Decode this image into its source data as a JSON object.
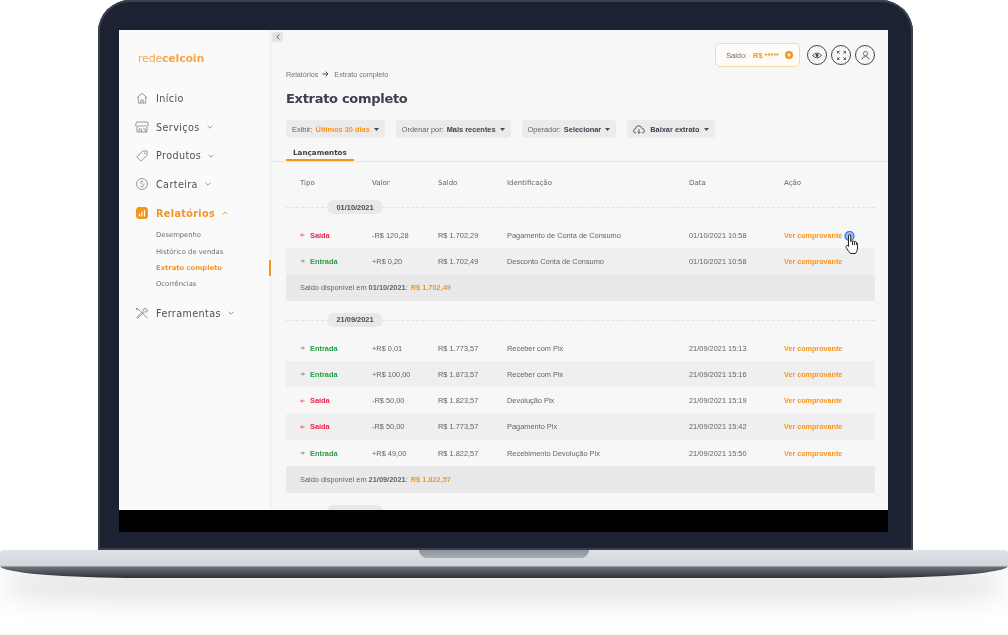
{
  "sidebar": {
    "logo": "rede**celcoin**",
    "items": [
      {
        "label": "Início",
        "kind": "link",
        "selected": false
      },
      {
        "label": "Serviços",
        "kind": "group",
        "expanded": false,
        "selected": false
      },
      {
        "label": "Produtos",
        "kind": "group",
        "expanded": false,
        "selected": false
      },
      {
        "label": "Carteira",
        "kind": "group",
        "expanded": false,
        "selected": false
      },
      {
        "label": "Relatórios",
        "kind": "group",
        "expanded": true,
        "selected": true,
        "children": [
          {
            "label": "Desempenho",
            "selected": false
          },
          {
            "label": "Histórico de vendas",
            "selected": false
          },
          {
            "label": "Extrato completo",
            "selected": true
          },
          {
            "label": "Ocorrências",
            "selected": false
          }
        ]
      },
      {
        "label": "Ferramentas",
        "kind": "group",
        "expanded": false,
        "selected": false
      }
    ]
  },
  "header": {
    "balance": {
      "label": "Saldo:",
      "value": "R$ *****"
    }
  },
  "breadcrumb": [
    "Relatórios",
    "Extrato completo"
  ],
  "title": "Extrato completo",
  "filters": [
    {
      "kind": "select",
      "label": "Exibir:",
      "value": "Últimos 30 dias",
      "highlighted": true
    },
    {
      "kind": "select",
      "label": "Ordenar por:",
      "value": "Mais recentes",
      "highlighted": false
    },
    {
      "kind": "select",
      "label": "Operador:",
      "value": "Selecionar",
      "highlighted": false
    },
    {
      "kind": "download",
      "value": "Baixar extrato"
    }
  ],
  "tabs": [
    {
      "label": "Lançamentos",
      "selected": true
    }
  ],
  "table": {
    "columns": [
      "Tipo",
      "Valor",
      "Saldo",
      "Identificação",
      "Data",
      "Ação"
    ],
    "groups": [
      {
        "date": "01/10/2021",
        "rows": [
          {
            "kind": "out",
            "type": "Saída",
            "value": "-R$ 120,28",
            "balance": "R$ 1.702,29",
            "description": "Pagamento de Conta de Consumo",
            "datetime": "01/10/2021 10:58",
            "action": "Ver comprovante"
          },
          {
            "kind": "in",
            "type": "Entrada",
            "value": "+R$ 0,20",
            "balance": "R$ 1.702,49",
            "description": "Desconto Conta de Consumo",
            "datetime": "01/10/2021 10:58",
            "action": "Ver comprovante"
          }
        ],
        "summary": {
          "label": "Saldo disponível em **01/10/2021**:",
          "amount": "R$ 1.702,49"
        }
      },
      {
        "date": "21/09/2021",
        "rows": [
          {
            "kind": "in",
            "type": "Entrada",
            "value": "+R$ 0,01",
            "balance": "R$ 1.773,57",
            "description": "Receber com Pix",
            "datetime": "21/09/2021 15:13",
            "action": "Ver comprovante"
          },
          {
            "kind": "in",
            "type": "Entrada",
            "value": "+R$ 100,00",
            "balance": "R$ 1.873,57",
            "description": "Receber com Pix",
            "datetime": "21/09/2021 15:16",
            "action": "Ver comprovante"
          },
          {
            "kind": "out",
            "type": "Saída",
            "value": "-R$ 50,00",
            "balance": "R$ 1.823,57",
            "description": "Devolução Pix",
            "datetime": "21/09/2021 15:19",
            "action": "Ver comprovante"
          },
          {
            "kind": "out",
            "type": "Saída",
            "value": "-R$ 50,00",
            "balance": "R$ 1.773,57",
            "description": "Pagamento Pix",
            "datetime": "21/09/2021 15:42",
            "action": "Ver comprovante"
          },
          {
            "kind": "in",
            "type": "Entrada",
            "value": "+R$ 49,00",
            "balance": "R$ 1.822,57",
            "description": "Recebimento Devolução Pix",
            "datetime": "21/09/2021 15:50",
            "action": "Ver comprovante"
          }
        ],
        "summary": {
          "label": "Saldo disponível em **21/09/2021**:",
          "amount": "R$ 1.822,57"
        }
      }
    ],
    "more_groups_below": true
  }
}
